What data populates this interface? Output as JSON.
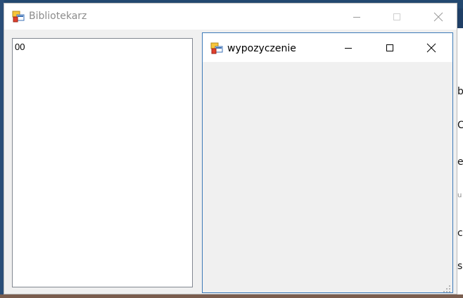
{
  "main_window": {
    "title": "Bibliotekarz",
    "icon": "app-form-icon",
    "controls": {
      "minimize": "minimize-icon",
      "maximize": "maximize-icon",
      "close": "close-icon"
    }
  },
  "listbox": {
    "items": [
      "00"
    ]
  },
  "child_window": {
    "title": "wypozyczenie",
    "icon": "app-form-icon",
    "controls": {
      "minimize": "minimize-icon",
      "maximize": "maximize-icon",
      "close": "close-icon"
    }
  },
  "colors": {
    "desktop": "#1f3f66",
    "window_bg": "#f0f0f0",
    "titlebar_bg": "#ffffff",
    "child_border": "#3d7ab8"
  }
}
